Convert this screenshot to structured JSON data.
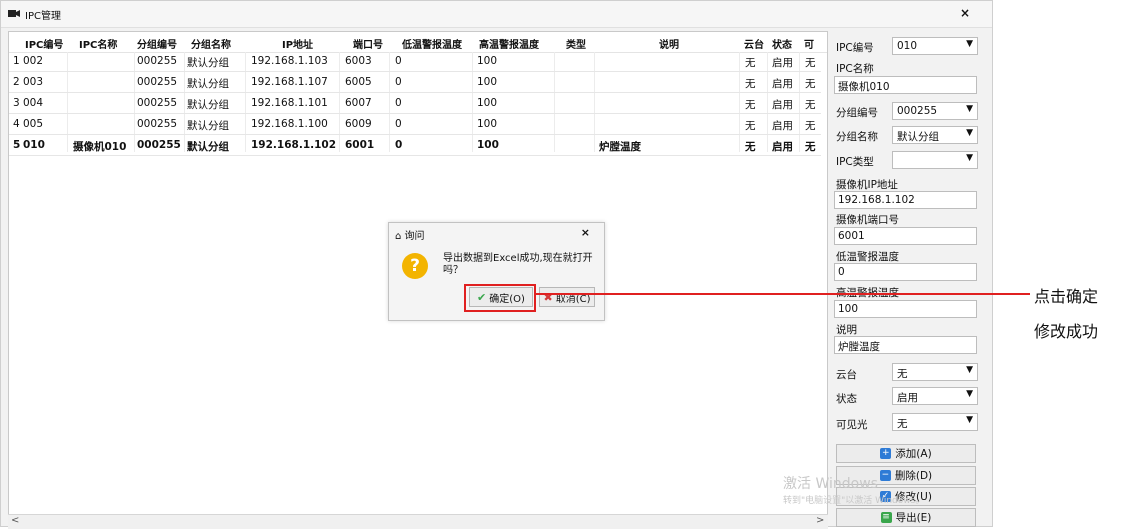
{
  "window": {
    "title": "IPC管理",
    "close": "×"
  },
  "table": {
    "columns": [
      "IPC编号",
      "IPC名称",
      "分组编号",
      "分组名称",
      "IP地址",
      "端口号",
      "低温警报温度",
      "高温警报温度",
      "类型",
      "说明",
      "云台",
      "状态",
      "可"
    ],
    "rows": [
      {
        "idx": "1",
        "id": "002",
        "name": "",
        "gid": "000255",
        "gname": "默认分组",
        "ip": "192.168.1.103",
        "port": "6003",
        "low": "0",
        "high": "100",
        "type": "",
        "desc": "",
        "ptz": "无",
        "status": "启用",
        "vis": "无"
      },
      {
        "idx": "2",
        "id": "003",
        "name": "",
        "gid": "000255",
        "gname": "默认分组",
        "ip": "192.168.1.107",
        "port": "6005",
        "low": "0",
        "high": "100",
        "type": "",
        "desc": "",
        "ptz": "无",
        "status": "启用",
        "vis": "无"
      },
      {
        "idx": "3",
        "id": "004",
        "name": "",
        "gid": "000255",
        "gname": "默认分组",
        "ip": "192.168.1.101",
        "port": "6007",
        "low": "0",
        "high": "100",
        "type": "",
        "desc": "",
        "ptz": "无",
        "status": "启用",
        "vis": "无"
      },
      {
        "idx": "4",
        "id": "005",
        "name": "",
        "gid": "000255",
        "gname": "默认分组",
        "ip": "192.168.1.100",
        "port": "6009",
        "low": "0",
        "high": "100",
        "type": "",
        "desc": "",
        "ptz": "无",
        "status": "启用",
        "vis": "无"
      },
      {
        "idx": "5",
        "id": "010",
        "name": "摄像机010",
        "gid": "000255",
        "gname": "默认分组",
        "ip": "192.168.1.102",
        "port": "6001",
        "low": "0",
        "high": "100",
        "type": "",
        "desc": "炉膛温度",
        "ptz": "无",
        "status": "启用",
        "vis": "无"
      }
    ]
  },
  "panel": {
    "ipc_id_label": "IPC编号",
    "ipc_id_value": "010",
    "ipc_name_label": "IPC名称",
    "ipc_name_value": "摄像机010",
    "group_id_label": "分组编号",
    "group_id_value": "000255",
    "group_name_label": "分组名称",
    "group_name_value": "默认分组",
    "ipc_type_label": "IPC类型",
    "ipc_type_value": "",
    "ip_label": "摄像机IP地址",
    "ip_value": "192.168.1.102",
    "port_label": "摄像机端口号",
    "port_value": "6001",
    "low_label": "低温警报温度",
    "low_value": "0",
    "high_label": "高温警报温度",
    "high_value": "100",
    "desc_label": "说明",
    "desc_value": "炉膛温度",
    "ptz_label": "云台",
    "ptz_value": "无",
    "status_label": "状态",
    "status_value": "启用",
    "vis_label": "可见光",
    "vis_value": "无",
    "add_button": "添加(A)",
    "delete_button": "删除(D)",
    "modify_button": "修改(U)",
    "export_button": "导出(E)"
  },
  "watermark": {
    "line1": "激活 Windows",
    "line2": "转到\"电脑设置\"以激活 Windows。"
  },
  "dialog": {
    "title": "询问",
    "close": "×",
    "message": "导出数据到Excel成功,现在就打开吗？",
    "ok": "确定(O)",
    "cancel": "取消(C)"
  },
  "annotation": {
    "line1": "点击确定",
    "line2": "修改成功"
  },
  "colors": {
    "highlight": "#e02020",
    "question_icon": "#f3b400",
    "button_blue": "#2e7bd6",
    "ok_green": "#3aa64c",
    "cancel_red": "#d23a3a"
  }
}
